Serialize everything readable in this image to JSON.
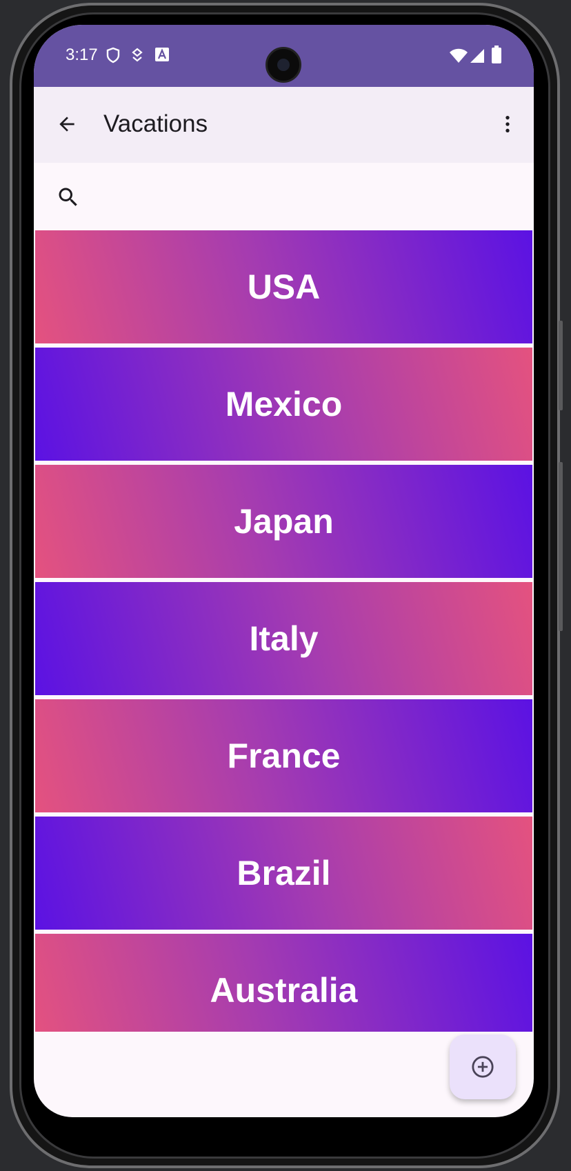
{
  "status_bar": {
    "time": "3:17"
  },
  "app_bar": {
    "title": "Vacations"
  },
  "search": {
    "placeholder": ""
  },
  "destinations": [
    "USA",
    "Mexico",
    "Japan",
    "Italy",
    "France",
    "Brazil",
    "Australia"
  ],
  "colors": {
    "status_bar": "#6552a2",
    "app_bar": "#f3edf6",
    "gradient_pink": "#e4527f",
    "gradient_violet": "#5b12e3",
    "fab": "#ebe1fb"
  },
  "icons": {
    "back": "arrow-back-icon",
    "menu": "more-vert-icon",
    "search": "search-icon",
    "fab": "add-circle-icon"
  }
}
